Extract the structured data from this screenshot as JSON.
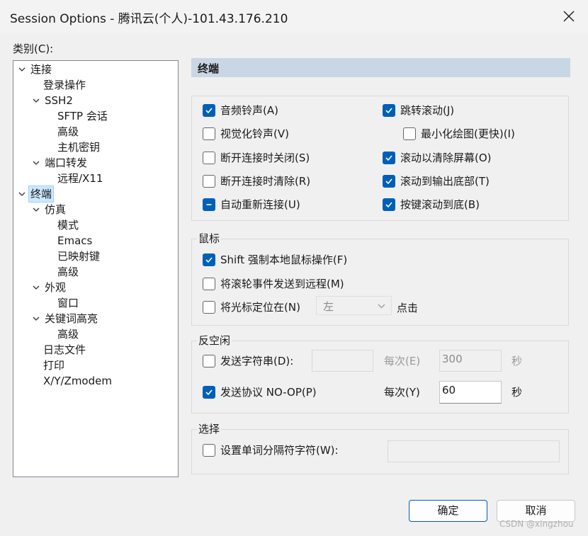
{
  "window": {
    "title": "Session Options - 腾讯云(个人)-101.43.176.210"
  },
  "category_label": "类别(C):",
  "tree": {
    "items": [
      {
        "label": "连接"
      },
      {
        "label": "登录操作"
      },
      {
        "label": "SSH2"
      },
      {
        "label": "SFTP 会话"
      },
      {
        "label": "高级"
      },
      {
        "label": "主机密钥"
      },
      {
        "label": "端口转发"
      },
      {
        "label": "远程/X11"
      },
      {
        "label": "终端",
        "selected": true
      },
      {
        "label": "仿真"
      },
      {
        "label": "模式"
      },
      {
        "label": "Emacs"
      },
      {
        "label": "已映射键"
      },
      {
        "label": "高级"
      },
      {
        "label": "外观"
      },
      {
        "label": "窗口"
      },
      {
        "label": "关键词高亮"
      },
      {
        "label": "高级"
      },
      {
        "label": "日志文件"
      },
      {
        "label": "打印"
      },
      {
        "label": "X/Y/Zmodem"
      }
    ]
  },
  "panel": {
    "header": "终端",
    "terminal_options": [
      {
        "label": "音频铃声(A)",
        "checked": true
      },
      {
        "label": "视觉化铃声(V)",
        "checked": false
      },
      {
        "label": "断开连接时关闭(S)",
        "checked": false
      },
      {
        "label": "断开连接时清除(R)",
        "checked": false
      },
      {
        "label": "自动重新连接(U)",
        "checked": "indeterminate"
      },
      {
        "label": "跳转滚动(J)",
        "checked": true
      },
      {
        "label": "最小化绘图(更快)(I)",
        "checked": false
      },
      {
        "label": "滚动以清除屏幕(O)",
        "checked": true
      },
      {
        "label": "滚动到输出底部(T)",
        "checked": true
      },
      {
        "label": "按键滚动到底(B)",
        "checked": true
      }
    ],
    "mouse": {
      "title": "鼠标",
      "shift_label": "Shift 强制本地鼠标操作(F)",
      "shift_checked": true,
      "wheel_label": "将滚轮事件发送到远程(M)",
      "wheel_checked": false,
      "cursor_label": "将光标定位在(N)",
      "cursor_checked": false,
      "cursor_select": "左",
      "cursor_suffix": "点击"
    },
    "keepalive": {
      "title": "反空闲",
      "send_string_label": "发送字符串(D):",
      "send_string_checked": false,
      "send_string_value": "",
      "every1_label": "每次(E)",
      "every1_value": "300",
      "every1_unit": "秒",
      "noop_label": "发送协议 NO-OP(P)",
      "noop_checked": true,
      "every2_label": "每次(Y)",
      "every2_value": "60",
      "every2_unit": "秒"
    },
    "select": {
      "title": "选择",
      "delim_label": "设置单词分隔符字符(W):",
      "delim_checked": false,
      "delim_value": ""
    }
  },
  "buttons": {
    "ok": "确定",
    "cancel": "取消"
  },
  "watermark": "CSDN @xingzhou",
  "colors": {
    "accent": "#005fb8",
    "header_bg": "#c9d7e5",
    "selection": "#cce8ff"
  }
}
